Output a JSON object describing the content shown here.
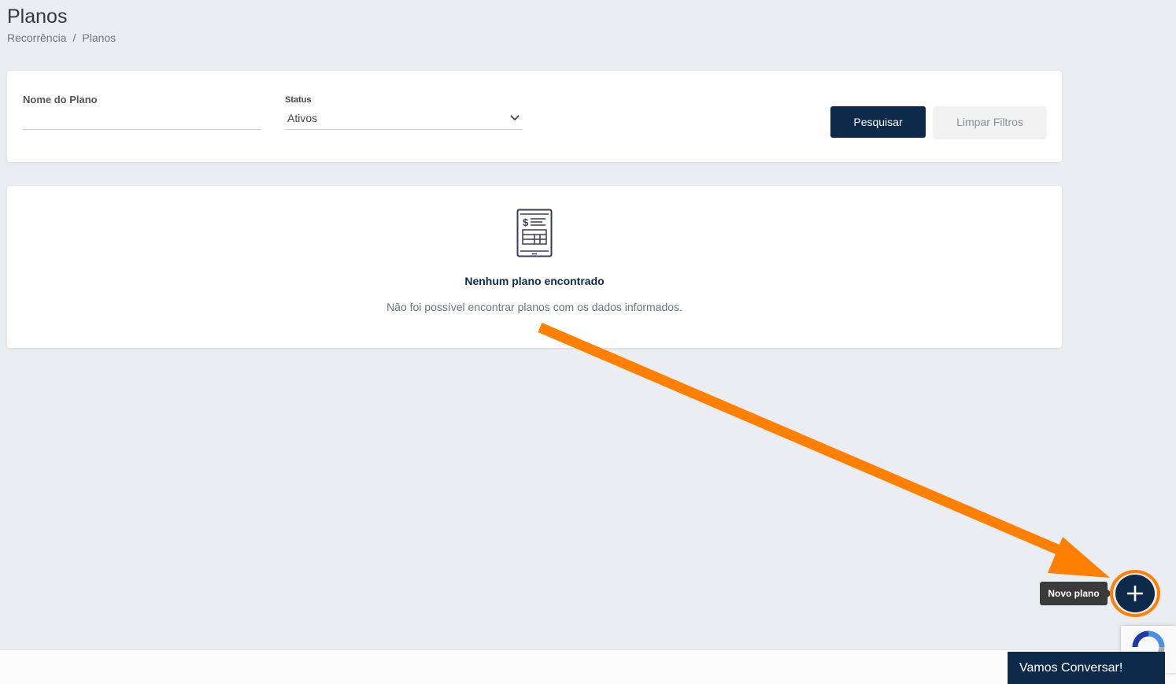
{
  "header": {
    "title": "Planos",
    "breadcrumb": [
      "Recorrência",
      "Planos"
    ],
    "breadcrumb_separator": "/"
  },
  "filters": {
    "name_label": "Nome do Plano",
    "name_value": "",
    "status_label": "Status",
    "status_value": "Ativos",
    "search_button": "Pesquisar",
    "clear_button": "Limpar Filtros"
  },
  "empty_state": {
    "icon": "invoice-icon",
    "title": "Nenhum plano encontrado",
    "description": "Não foi possível encontrar planos com os dados informados."
  },
  "fab": {
    "tooltip": "Novo plano",
    "icon": "plus-icon"
  },
  "chat": {
    "label": "Vamos Conversar!"
  },
  "colors": {
    "primary": "#0e2a4a",
    "annotation": "#ff7f00",
    "background": "#eaedf1"
  }
}
